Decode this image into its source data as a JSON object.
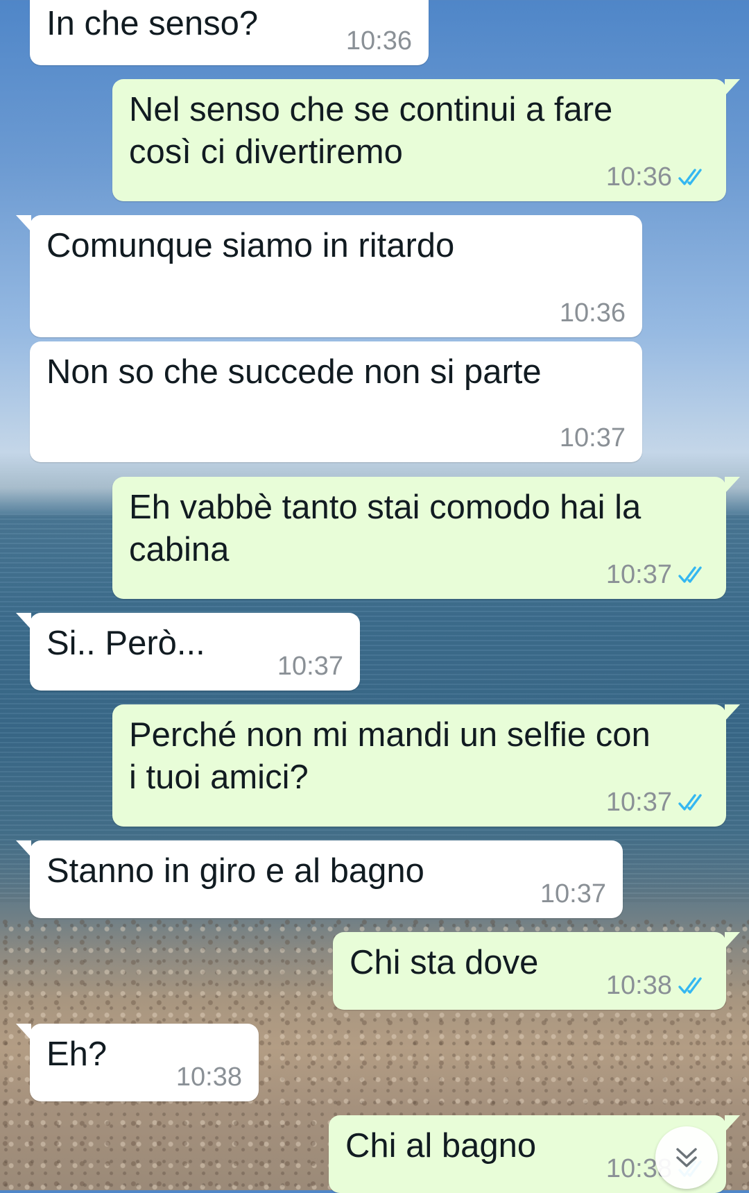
{
  "colors": {
    "incoming_bubble": "#ffffff",
    "outgoing_bubble": "#e8fdd8",
    "read_ticks": "#34b7f1",
    "timestamp": "#8a9096"
  },
  "messages": [
    {
      "direction": "incoming",
      "text": "In che senso?",
      "time": "10:36"
    },
    {
      "direction": "outgoing",
      "text": "Nel senso che se continui a fare così ci divertiremo",
      "time": "10:36",
      "status": "read"
    },
    {
      "direction": "incoming",
      "text": "Comunque siamo in ritardo",
      "time": "10:36"
    },
    {
      "direction": "incoming",
      "text": "Non so che succede non si parte",
      "time": "10:37"
    },
    {
      "direction": "outgoing",
      "text": "Eh vabbè tanto stai comodo hai la cabina",
      "time": "10:37",
      "status": "read"
    },
    {
      "direction": "incoming",
      "text": "Si.. Però...",
      "time": "10:37"
    },
    {
      "direction": "outgoing",
      "text": "Perché non mi mandi un selfie con i tuoi amici?",
      "time": "10:37",
      "status": "read"
    },
    {
      "direction": "incoming",
      "text": "Stanno in giro e al bagno",
      "time": "10:37"
    },
    {
      "direction": "outgoing",
      "text": "Chi sta dove",
      "time": "10:38",
      "status": "read"
    },
    {
      "direction": "incoming",
      "text": "Eh?",
      "time": "10:38"
    },
    {
      "direction": "outgoing",
      "text": "Chi al bagno",
      "time": "10:38",
      "status": "read"
    }
  ],
  "scroll_button": {
    "icon": "double-chevron-down-icon"
  }
}
